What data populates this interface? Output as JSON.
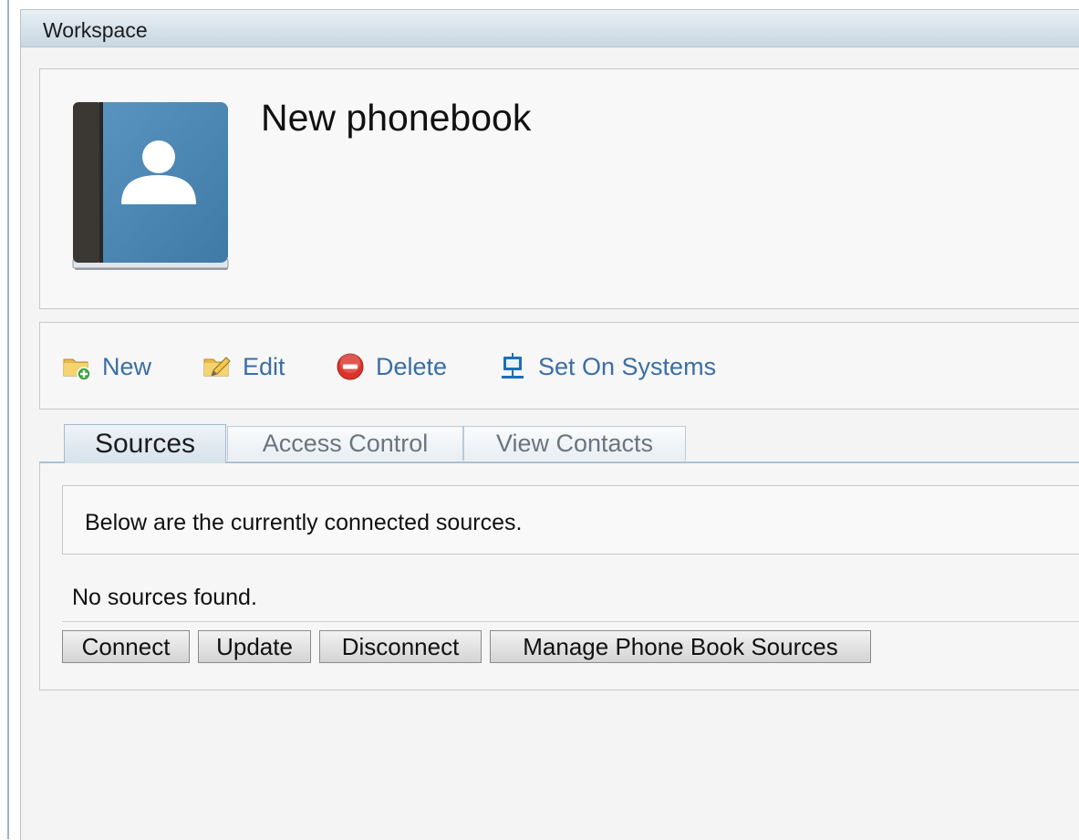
{
  "workspace": {
    "title": "Workspace"
  },
  "phonebook": {
    "name": "New phonebook",
    "icon": "phonebook-icon"
  },
  "actions": [
    {
      "label": "New",
      "icon": "new-folder-icon"
    },
    {
      "label": "Edit",
      "icon": "edit-folder-icon"
    },
    {
      "label": "Delete",
      "icon": "delete-icon"
    },
    {
      "label": "Set On Systems",
      "icon": "monitor-network-icon"
    }
  ],
  "tabs": [
    {
      "label": "Sources",
      "active": true
    },
    {
      "label": "Access Control",
      "active": false
    },
    {
      "label": "View Contacts",
      "active": false
    }
  ],
  "sources": {
    "info": "Below are the currently connected sources.",
    "empty": "No sources found."
  },
  "buttons": {
    "connect": "Connect",
    "update": "Update",
    "disconnect": "Disconnect",
    "manage": "Manage Phone Book Sources"
  },
  "colors": {
    "link": "#3a6ea5",
    "delete": "#d9342b",
    "book": "#4a86b3"
  }
}
